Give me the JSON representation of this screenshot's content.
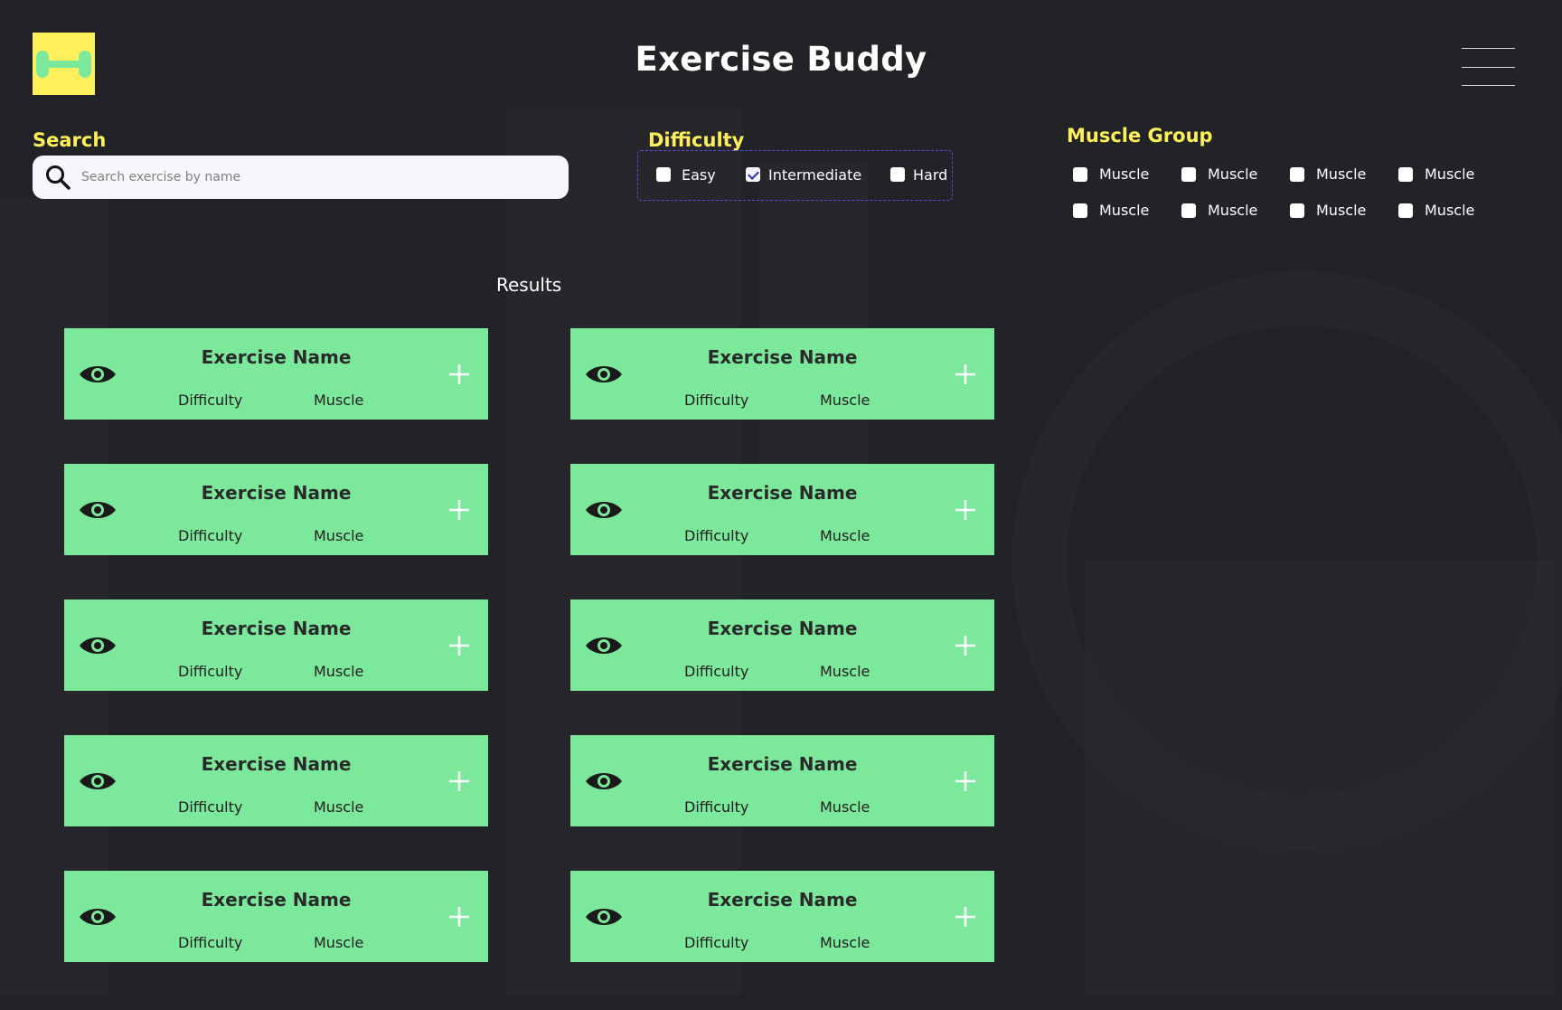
{
  "app": {
    "title": "Exercise Buddy"
  },
  "search": {
    "label": "Search",
    "placeholder": "Search exercise by name",
    "value": ""
  },
  "difficulty": {
    "label": "Difficulty",
    "options": [
      {
        "label": "Easy",
        "checked": false
      },
      {
        "label": "Intermediate",
        "checked": true
      },
      {
        "label": "Hard",
        "checked": false
      }
    ]
  },
  "muscle_group": {
    "label": "Muscle Group",
    "options": [
      {
        "label": "Muscle",
        "checked": false
      },
      {
        "label": "Muscle",
        "checked": false
      },
      {
        "label": "Muscle",
        "checked": false
      },
      {
        "label": "Muscle",
        "checked": false
      },
      {
        "label": "Muscle",
        "checked": false
      },
      {
        "label": "Muscle",
        "checked": false
      },
      {
        "label": "Muscle",
        "checked": false
      },
      {
        "label": "Muscle",
        "checked": false
      }
    ]
  },
  "results": {
    "label": "Results",
    "cards": [
      {
        "name": "Exercise Name",
        "difficulty": "Difficulty",
        "muscle": "Muscle"
      },
      {
        "name": "Exercise Name",
        "difficulty": "Difficulty",
        "muscle": "Muscle"
      },
      {
        "name": "Exercise Name",
        "difficulty": "Difficulty",
        "muscle": "Muscle"
      },
      {
        "name": "Exercise Name",
        "difficulty": "Difficulty",
        "muscle": "Muscle"
      },
      {
        "name": "Exercise Name",
        "difficulty": "Difficulty",
        "muscle": "Muscle"
      },
      {
        "name": "Exercise Name",
        "difficulty": "Difficulty",
        "muscle": "Muscle"
      },
      {
        "name": "Exercise Name",
        "difficulty": "Difficulty",
        "muscle": "Muscle"
      },
      {
        "name": "Exercise Name",
        "difficulty": "Difficulty",
        "muscle": "Muscle"
      },
      {
        "name": "Exercise Name",
        "difficulty": "Difficulty",
        "muscle": "Muscle"
      },
      {
        "name": "Exercise Name",
        "difficulty": "Difficulty",
        "muscle": "Muscle"
      }
    ]
  },
  "icons": {
    "logo": "dumbbell-icon",
    "menu": "hamburger-menu-icon",
    "search": "search-icon",
    "view": "eye-icon",
    "add": "plus-icon"
  },
  "colors": {
    "accent_yellow": "#fdf05a",
    "card_green": "#7ce89b",
    "logo_dumbbell": "#7ce89b",
    "dashed_border": "#5a49e0",
    "background": "#222326"
  }
}
